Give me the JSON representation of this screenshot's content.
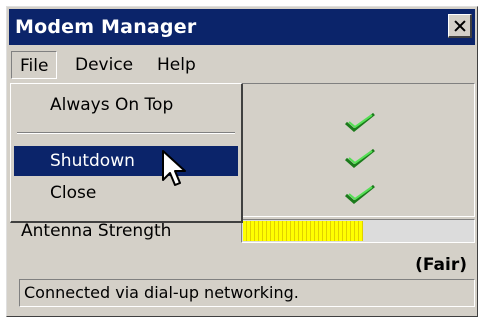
{
  "window": {
    "title": "Modem Manager"
  },
  "menubar": {
    "items": [
      "File",
      "Device",
      "Help"
    ]
  },
  "file_menu": {
    "items": [
      "Always On Top",
      "Shutdown",
      "Close"
    ],
    "highlighted": "Shutdown"
  },
  "status_checks": [
    "check-icon",
    "check-icon",
    "check-icon"
  ],
  "antenna": {
    "label": "Antenna Strength",
    "strength_percent": 52,
    "quality": "(Fair)"
  },
  "statusbar": {
    "text": "Connected via dial-up networking."
  },
  "colors": {
    "title_bar": "#0b246a",
    "highlight": "#0b246a",
    "strength_fill": "#ffff00",
    "check": "#2ec52e"
  }
}
